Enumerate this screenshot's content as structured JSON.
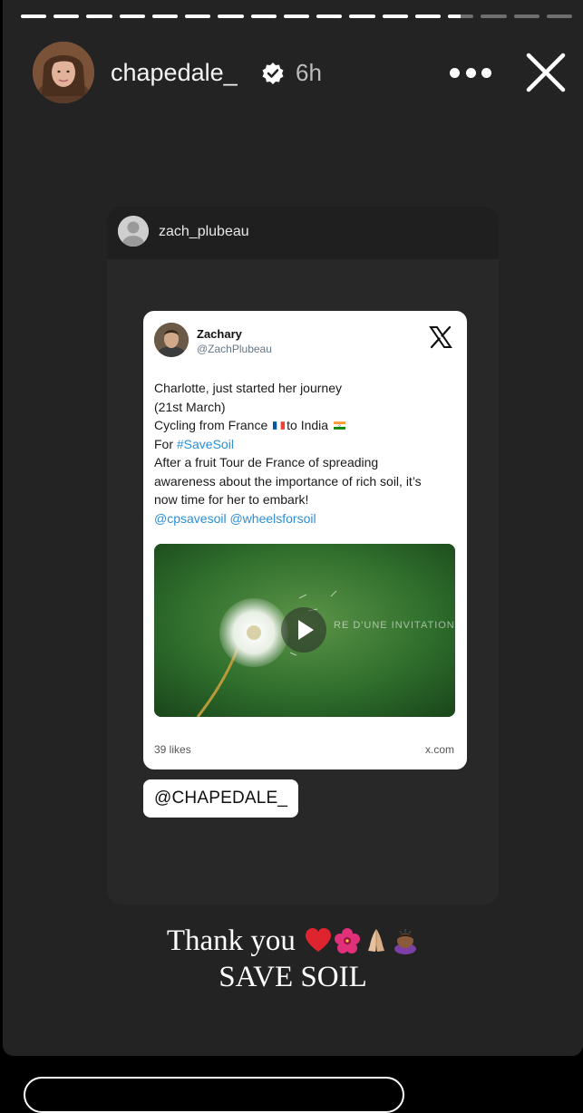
{
  "story": {
    "progress_segments": [
      1,
      1,
      1,
      1,
      1,
      1,
      1,
      1,
      1,
      1,
      1,
      1,
      1,
      0.5,
      0,
      0,
      0
    ],
    "header": {
      "username": "chapedale_",
      "time": "6h",
      "more_icon": "more-horizontal-icon",
      "close_icon": "close-icon"
    },
    "shared_post": {
      "username": "zach_plubeau"
    },
    "tweet": {
      "name": "Zachary",
      "handle": "@ZachPlubeau",
      "platform_icon": "x-logo-icon",
      "lines": {
        "l1": "Charlotte, just started her journey",
        "l2": "(21st March)",
        "l3a": "Cycling from France ",
        "l3b": "to India ",
        "l4a": "For ",
        "l4b": "#SaveSoil",
        "l5": "After a fruit Tour de France of spreading",
        "l6": "awareness about the importance of rich soil, it’s",
        "l7": "now time for her to embark!",
        "l8": "@cpsavesoil @wheelsforsoil"
      },
      "media_caption": "RE D'UNE INVITATION",
      "likes": "39 likes",
      "source": "x.com"
    },
    "mention_sticker": "@CHAPEDALE_",
    "caption": {
      "line1": "Thank you",
      "line2": "SAVE SOIL"
    },
    "colors": {
      "background": "#232323",
      "link": "#2b8fd6"
    }
  }
}
